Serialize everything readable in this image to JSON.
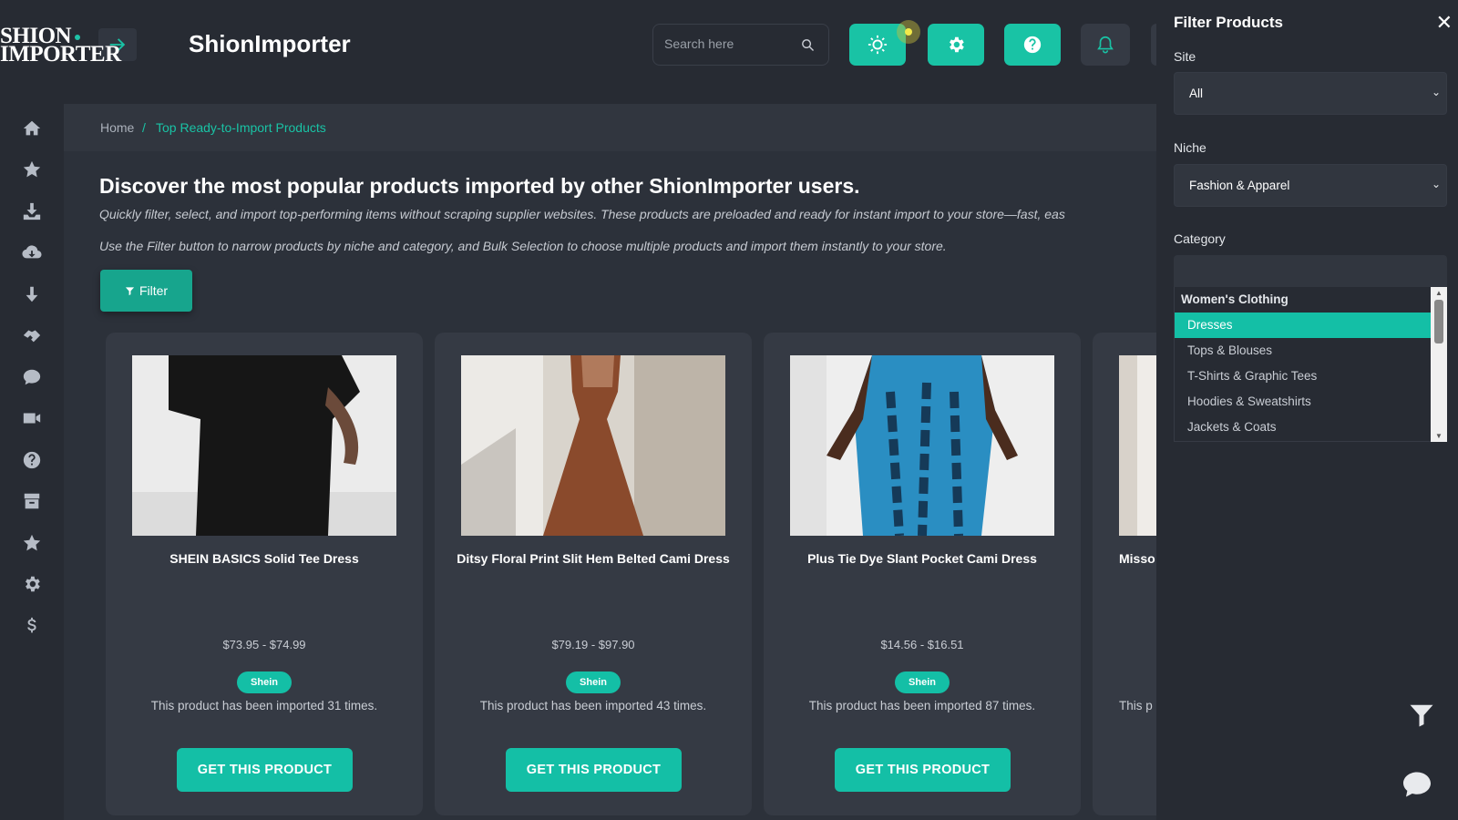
{
  "brand": {
    "logo_line1": "SHION",
    "logo_line2": "IMPORTER",
    "app_title": "ShionImporter"
  },
  "search": {
    "placeholder": "Search here"
  },
  "breadcrumb": {
    "home": "Home",
    "separator": "/",
    "current": "Top Ready-to-Import Products"
  },
  "main": {
    "heading": "Discover the most popular products imported by other ShionImporter users.",
    "desc1": "Quickly filter, select, and import top-performing items without scraping supplier websites. These products are preloaded and ready for instant import to your store—fast, eas",
    "desc2": "Use the Filter button to narrow products by niche and category, and Bulk Selection to choose multiple products and import them instantly to your store.",
    "filter_label": "Filter"
  },
  "products": [
    {
      "name": "SHEIN BASICS Solid Tee Dress",
      "price": "$73.95 - $74.99",
      "badge": "Shein",
      "imported": "This product has been imported 31 times.",
      "cta": "GET THIS PRODUCT"
    },
    {
      "name": "Ditsy Floral Print Slit Hem Belted Cami Dress",
      "price": "$79.19 - $97.90",
      "badge": "Shein",
      "imported": "This product has been imported 43 times.",
      "cta": "GET THIS PRODUCT"
    },
    {
      "name": "Plus Tie Dye Slant Pocket Cami Dress",
      "price": "$14.56 - $16.51",
      "badge": "Shein",
      "imported": "This product has been imported 87 times.",
      "cta": "GET THIS PRODUCT"
    },
    {
      "name": "Misso",
      "imported": "This p"
    }
  ],
  "filter_panel": {
    "title": "Filter Products",
    "site_label": "Site",
    "site_value": "All",
    "niche_label": "Niche",
    "niche_value": "Fashion & Apparel",
    "category_label": "Category",
    "category_group": "Women's Clothing",
    "category_items": [
      "Dresses",
      "Tops & Blouses",
      "T-Shirts & Graphic Tees",
      "Hoodies & Sweatshirts",
      "Jackets & Coats"
    ],
    "selected_category": "Dresses"
  },
  "colors": {
    "accent": "#14bfa6",
    "background": "#2c313a",
    "panel": "#272b33"
  }
}
